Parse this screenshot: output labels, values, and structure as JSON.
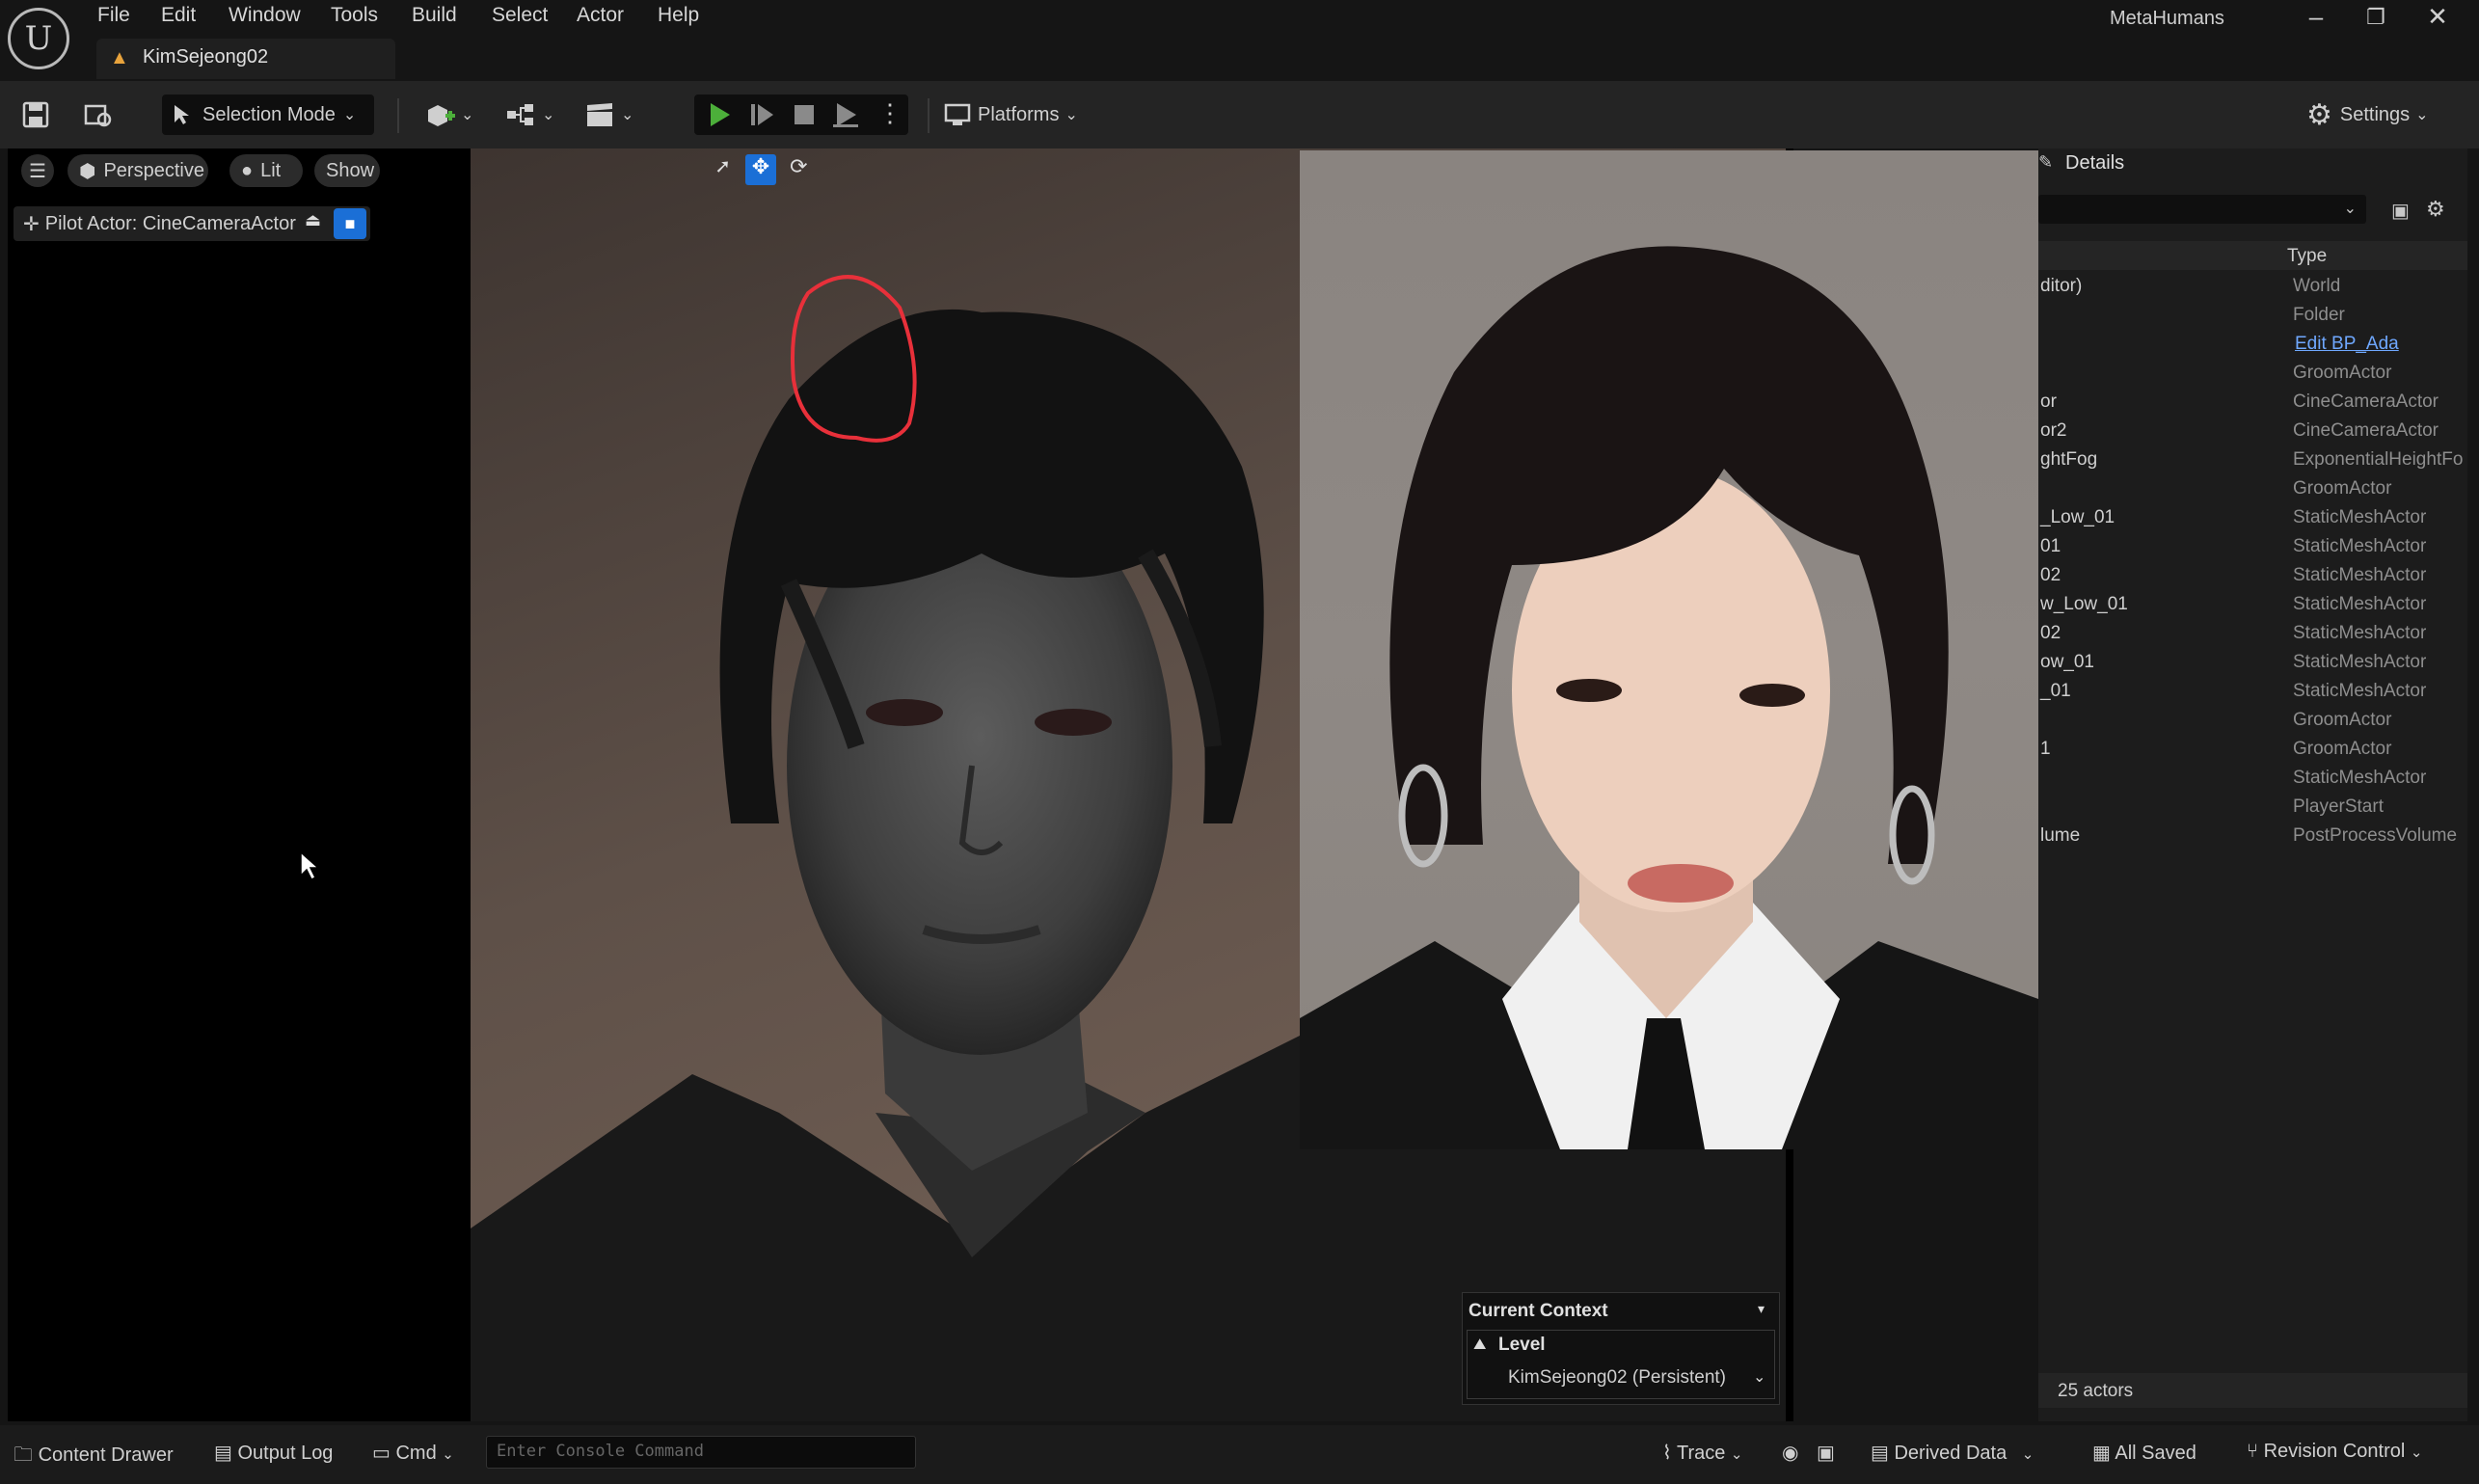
{
  "app": {
    "project_name": "MetaHumans",
    "tab_title": "KimSejeong02",
    "menu": [
      "File",
      "Edit",
      "Window",
      "Tools",
      "Build",
      "Select",
      "Actor",
      "Help"
    ]
  },
  "toolbar": {
    "selection_mode": "Selection Mode",
    "platforms": "Platforms",
    "settings": "Settings"
  },
  "viewport": {
    "perspective": "Perspective",
    "lit": "Lit",
    "show": "Show",
    "pilot_actor": "Pilot Actor: CineCameraActor"
  },
  "outliner": {
    "details_tab": "Details",
    "type_header": "Type",
    "rows": [
      {
        "name": "ditor)",
        "type": "World"
      },
      {
        "name": "",
        "type": "Folder"
      },
      {
        "name": "",
        "type": "Edit BP_Ada",
        "link": true
      },
      {
        "name": "",
        "type": "GroomActor"
      },
      {
        "name": "or",
        "type": "CineCameraActor"
      },
      {
        "name": "or2",
        "type": "CineCameraActor"
      },
      {
        "name": "ghtFog",
        "type": "ExponentialHeightFo"
      },
      {
        "name": "",
        "type": "GroomActor"
      },
      {
        "name": "_Low_01",
        "type": "StaticMeshActor"
      },
      {
        "name": "01",
        "type": "StaticMeshActor"
      },
      {
        "name": "02",
        "type": "StaticMeshActor"
      },
      {
        "name": "w_Low_01",
        "type": "StaticMeshActor"
      },
      {
        "name": "02",
        "type": "StaticMeshActor"
      },
      {
        "name": "ow_01",
        "type": "StaticMeshActor"
      },
      {
        "name": "_01",
        "type": "StaticMeshActor"
      },
      {
        "name": "",
        "type": "GroomActor"
      },
      {
        "name": "1",
        "type": "GroomActor"
      },
      {
        "name": "",
        "type": "StaticMeshActor"
      },
      {
        "name": "",
        "type": "PlayerStart"
      },
      {
        "name": "lume",
        "type": "PostProcessVolume"
      }
    ],
    "actor_count": "25 actors"
  },
  "context": {
    "title": "Current Context",
    "level_label": "Level",
    "level_value": "KimSejeong02 (Persistent)"
  },
  "statusbar": {
    "content_drawer": "Content Drawer",
    "output_log": "Output Log",
    "cmd": "Cmd",
    "console_placeholder": "Enter Console Command",
    "trace": "Trace",
    "derived_data": "Derived Data",
    "all_saved": "All Saved",
    "revision_control": "Revision Control"
  },
  "colors": {
    "accent_blue": "#1b6fd6",
    "play_green": "#4caf3a",
    "warning_orange": "#e8a33c",
    "annotation_red": "#e8303a"
  }
}
